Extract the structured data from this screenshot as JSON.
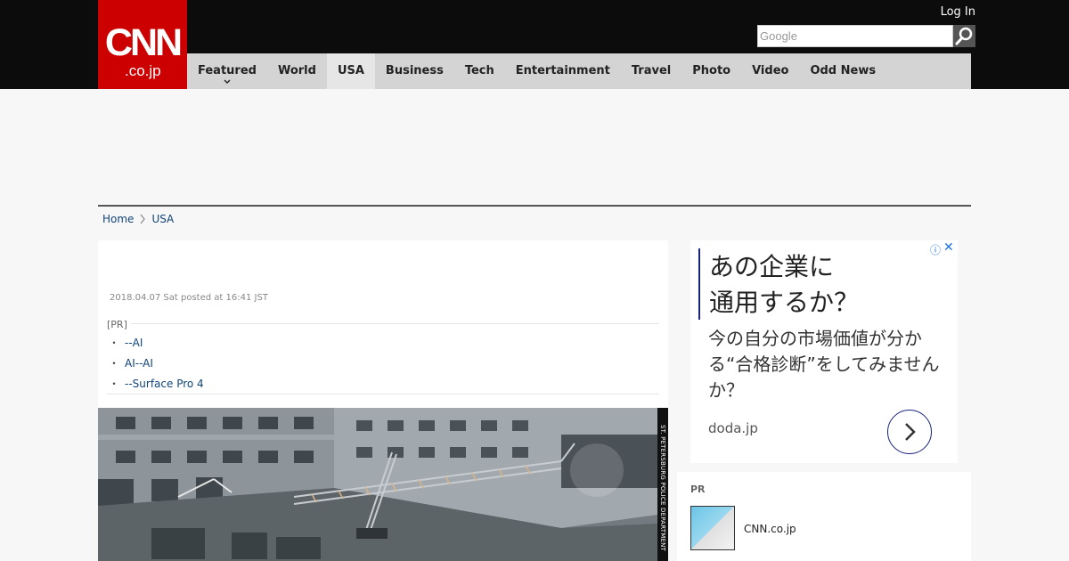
{
  "header": {
    "logo_main": "CNN",
    "logo_sub": ".co.jp",
    "login_label": "Log In",
    "search_placeholder": "Google"
  },
  "nav": {
    "items": [
      {
        "label": "Featured",
        "has_dropdown": true
      },
      {
        "label": "World"
      },
      {
        "label": "USA",
        "active": true
      },
      {
        "label": "Business"
      },
      {
        "label": "Tech"
      },
      {
        "label": "Entertainment"
      },
      {
        "label": "Travel"
      },
      {
        "label": "Photo"
      },
      {
        "label": "Video"
      },
      {
        "label": "Odd News"
      }
    ]
  },
  "breadcrumb": {
    "home": "Home",
    "current": "USA"
  },
  "article": {
    "date": "2018.04.07 Sat posted at 16:41 JST",
    "pr_label": "[PR]",
    "pr_links": [
      "--AI",
      "AI--AI",
      "--Surface Pro 4"
    ],
    "photo_credit": "ST. PETERSBURG POLICE DEPARTMENT"
  },
  "ad": {
    "headline_line1": "あの企業に",
    "headline_line2": "通用するか？",
    "body": "今の自分の市場価値が分かる“合格診断”をしてみませんか？",
    "domain": "doda.jp"
  },
  "pr_box": {
    "label": "PR",
    "title": "CNN.co.jp"
  },
  "colors": {
    "brand_red": "#cc0000",
    "topbar": "#0c0c0c",
    "link": "#114477",
    "ad_accent": "#1a237e"
  }
}
